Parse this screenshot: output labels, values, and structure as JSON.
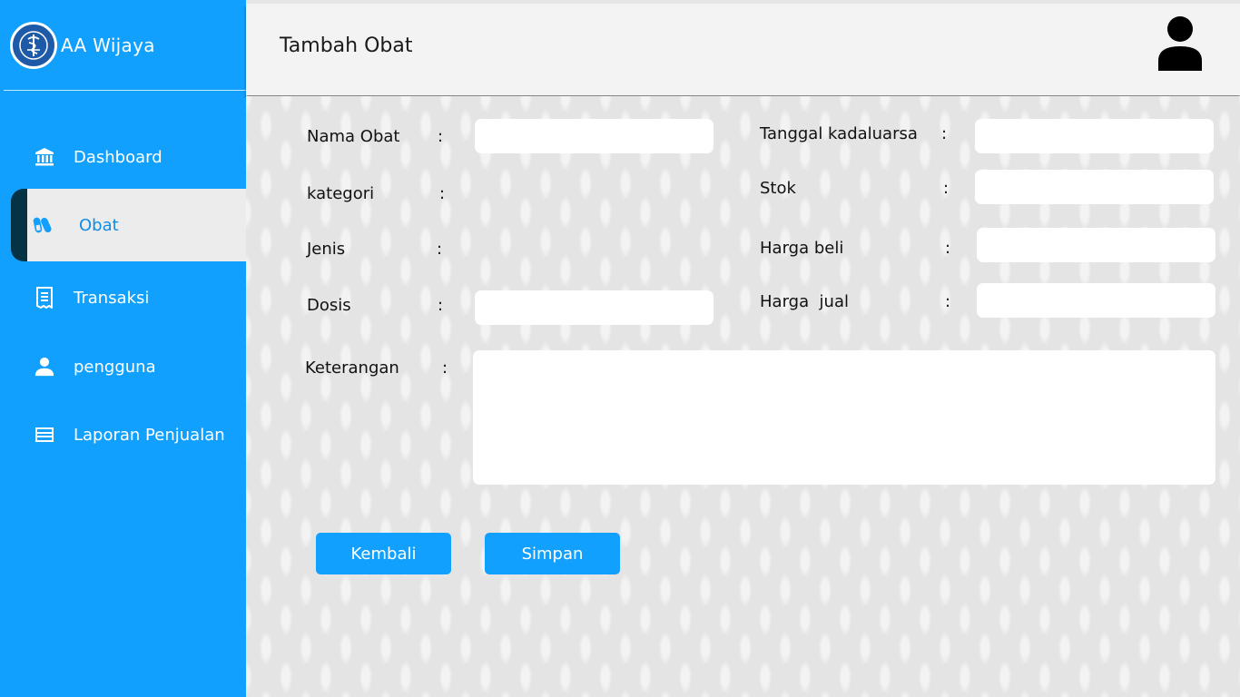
{
  "brand": {
    "name": "AA Wijaya",
    "logo_icon": "caduceus-icon"
  },
  "sidebar": {
    "items": [
      {
        "label": "Dashboard",
        "icon": "bank-icon",
        "active": false
      },
      {
        "label": "Obat",
        "icon": "pills-icon",
        "active": true
      },
      {
        "label": "Transaksi",
        "icon": "receipt-icon",
        "active": false
      },
      {
        "label": "pengguna",
        "icon": "user-icon",
        "active": false
      },
      {
        "label": "Laporan Penjualan",
        "icon": "report-icon",
        "active": false
      }
    ]
  },
  "header": {
    "title": "Tambah Obat",
    "avatar_icon": "user-avatar-icon"
  },
  "form": {
    "separator": ":",
    "nama_obat": {
      "label": "Nama Obat",
      "value": ""
    },
    "kategori": {
      "label": "kategori"
    },
    "jenis": {
      "label": "Jenis"
    },
    "dosis": {
      "label": "Dosis",
      "value": ""
    },
    "keterangan": {
      "label": "Keterangan",
      "value": ""
    },
    "tanggal_kadaluarsa": {
      "label": "Tanggal kadaluarsa",
      "value": ""
    },
    "stok": {
      "label": "Stok",
      "value": ""
    },
    "harga_beli": {
      "label": "Harga beli",
      "value": ""
    },
    "harga_jual": {
      "label": "Harga  jual",
      "value": ""
    }
  },
  "buttons": {
    "back_label": "Kembali",
    "save_label": "Simpan"
  },
  "colors": {
    "sidebar": "#12a0ff",
    "active_item_bg": "#ececec",
    "active_item_marker": "#063246",
    "button": "#12a0ff",
    "header": "#f3f3f3"
  }
}
